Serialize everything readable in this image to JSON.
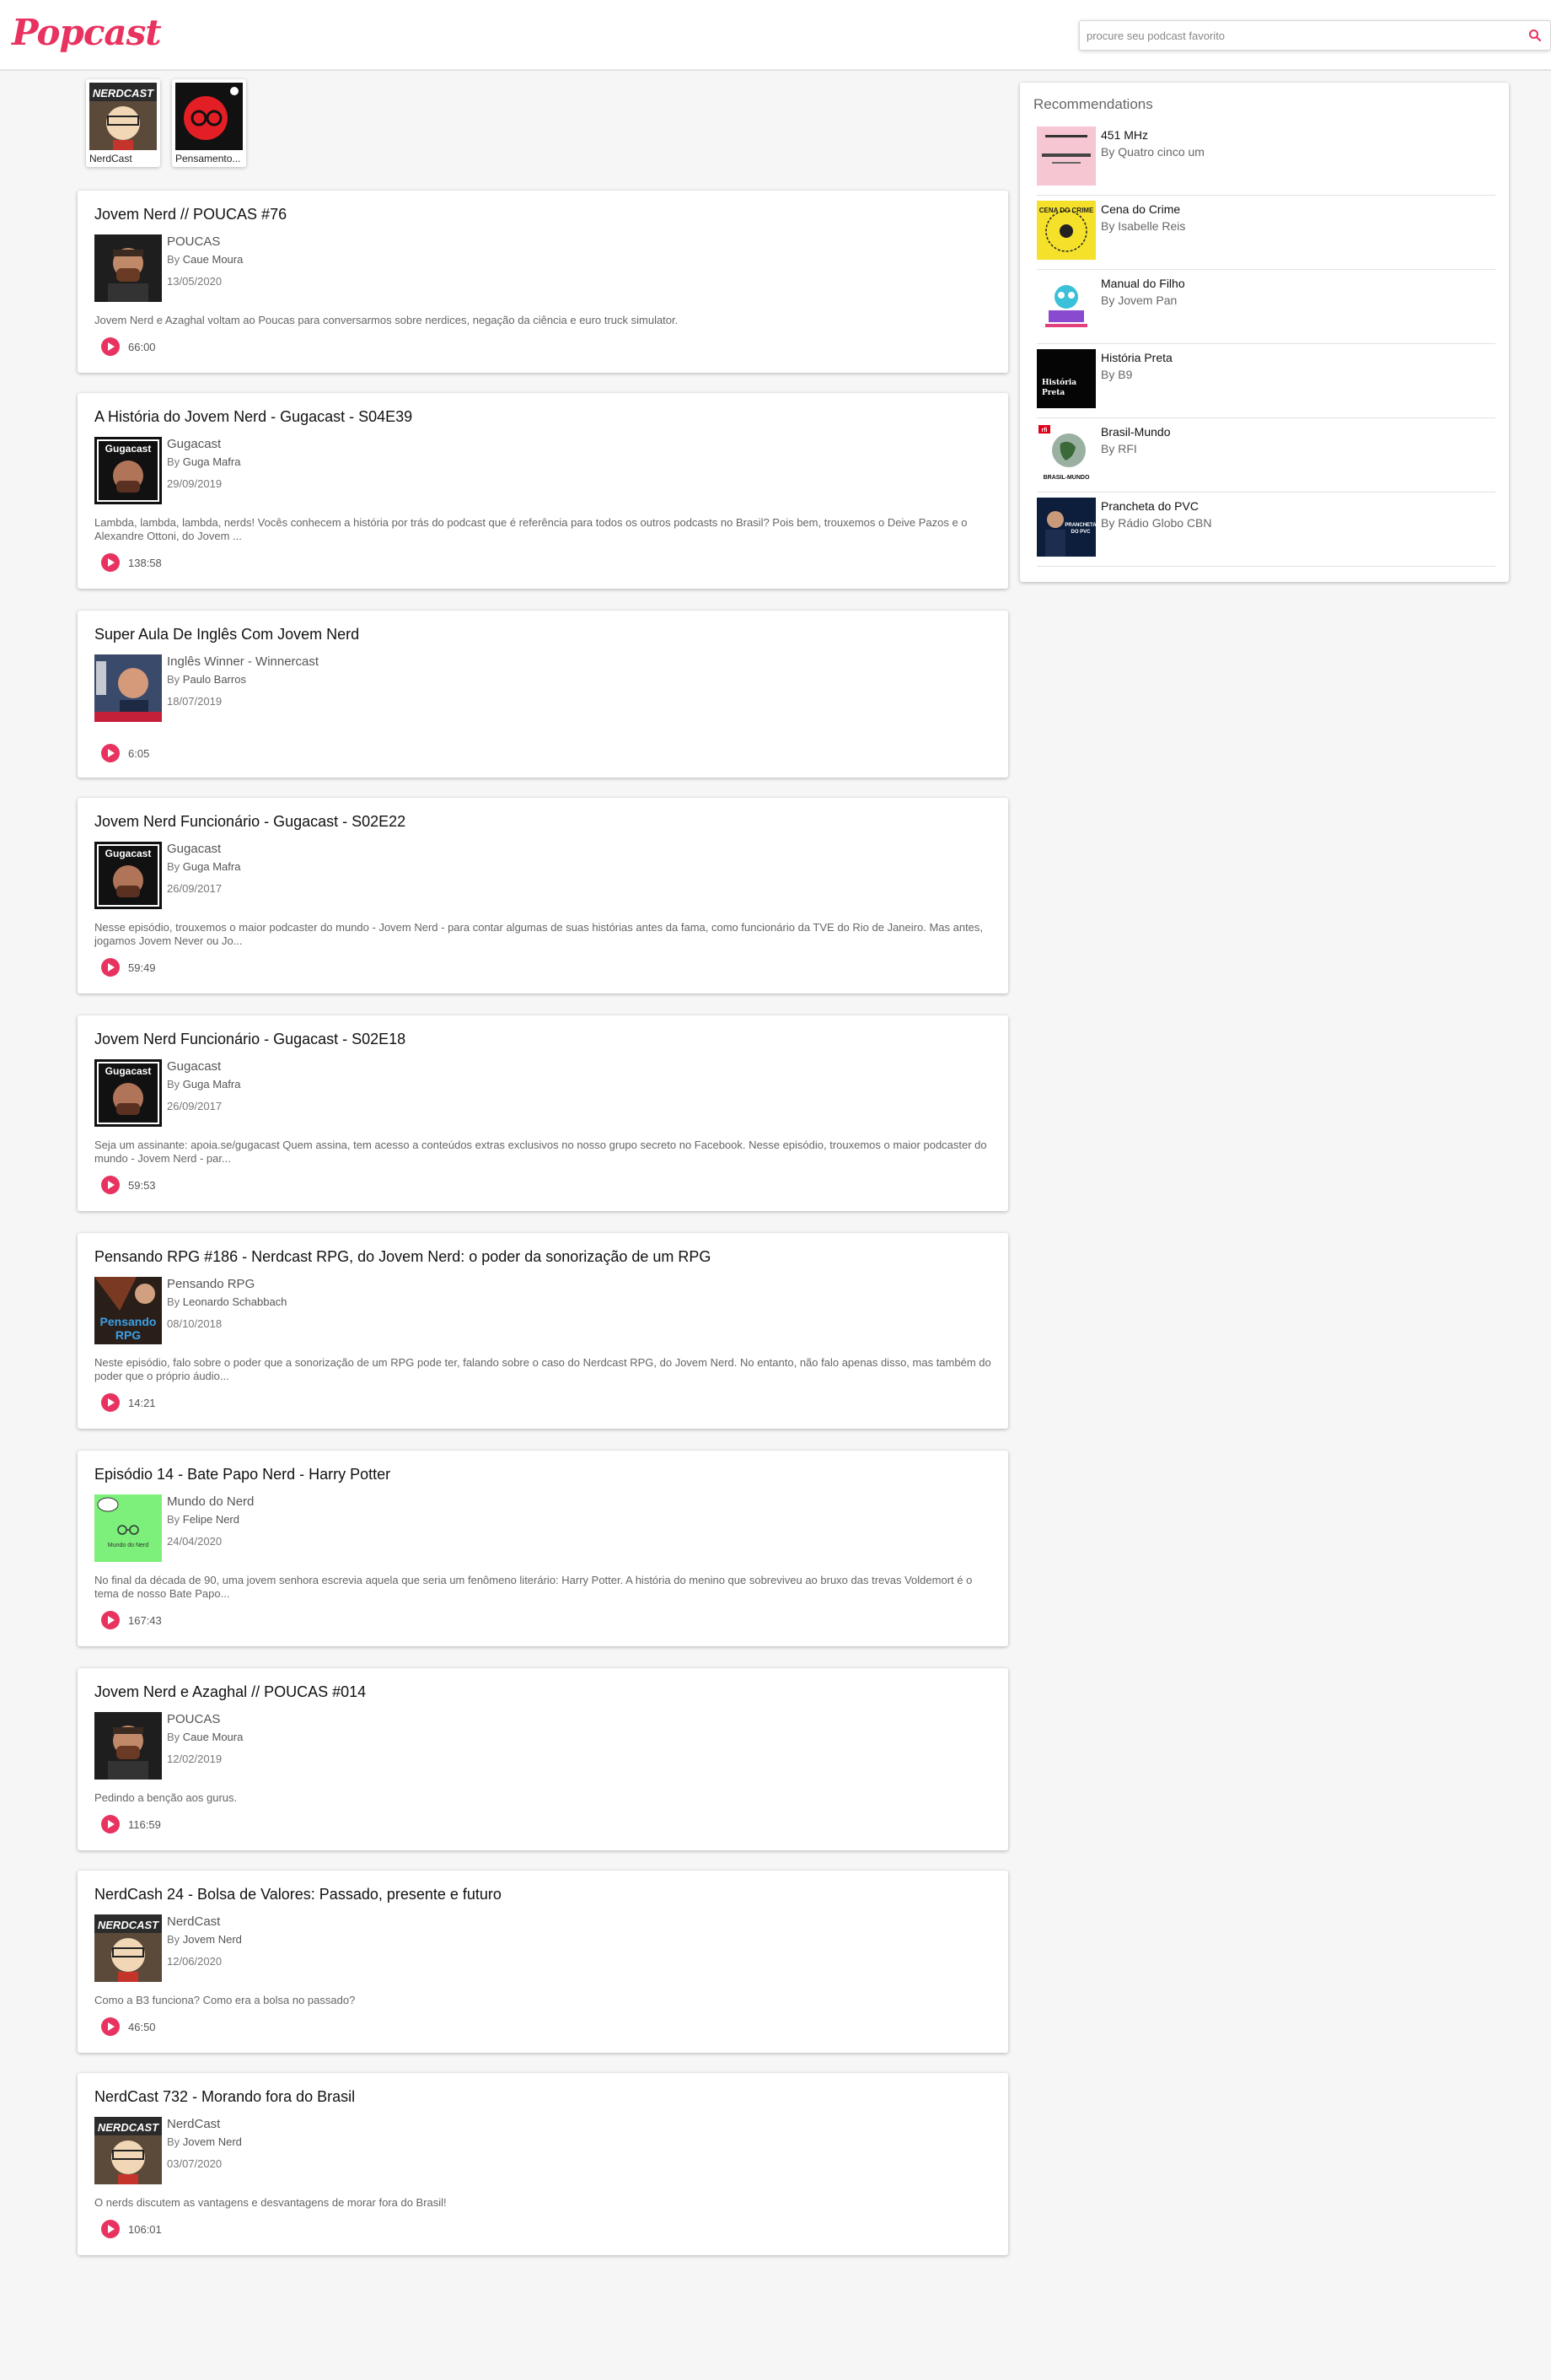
{
  "brand": {
    "logo": "Popcast",
    "accent_color": "#e8325f"
  },
  "search": {
    "placeholder": "procure seu podcast favorito",
    "value": "",
    "icon": "search-icon"
  },
  "subscriptions": [
    {
      "label": "NerdCast"
    },
    {
      "label": "Pensamento..."
    }
  ],
  "episodes": [
    {
      "title": "Jovem Nerd // POUCAS #76",
      "podcast": "POUCAS",
      "by": "By",
      "author": "Caue Moura",
      "date": "13/05/2020",
      "description": "Jovem Nerd e Azaghal voltam ao Poucas para conversarmos sobre nerdices, negação da ciência e euro truck simulator.",
      "duration": "66:00"
    },
    {
      "title": "A História do Jovem Nerd - Gugacast - S04E39",
      "podcast": "Gugacast",
      "by": "By",
      "author": "Guga Mafra",
      "date": "29/09/2019",
      "description": "Lambda, lambda, lambda, nerds! Vocês conhecem a história por trás do podcast que é referência para todos os outros podcasts no Brasil? Pois bem, trouxemos o Deive Pazos e o Alexandre Ottoni, do Jovem ...",
      "duration": "138:58"
    },
    {
      "title": "Super Aula De Inglês Com Jovem Nerd",
      "podcast": "Inglês Winner - Winnercast",
      "by": "By",
      "author": "Paulo Barros",
      "date": "18/07/2019",
      "description": "",
      "duration": "6:05"
    },
    {
      "title": "Jovem Nerd Funcionário - Gugacast - S02E22",
      "podcast": "Gugacast",
      "by": "By",
      "author": "Guga Mafra",
      "date": "26/09/2017",
      "description": "Nesse episódio, trouxemos o maior podcaster do mundo - Jovem Nerd - para contar algumas de suas histórias antes da fama, como funcionário da TVE do Rio de Janeiro. Mas antes, jogamos Jovem Never ou Jo...",
      "duration": "59:49"
    },
    {
      "title": "Jovem Nerd Funcionário - Gugacast - S02E18",
      "podcast": "Gugacast",
      "by": "By",
      "author": "Guga Mafra",
      "date": "26/09/2017",
      "description": "Seja um assinante: apoia.se/gugacast Quem assina, tem acesso a conteúdos extras exclusivos no nosso grupo secreto no Facebook. Nesse episódio, trouxemos o maior podcaster do mundo - Jovem Nerd - par...",
      "duration": "59:53"
    },
    {
      "title": "Pensando RPG #186 - Nerdcast RPG, do Jovem Nerd: o poder da sonorização de um RPG",
      "podcast": "Pensando RPG",
      "by": "By",
      "author": "Leonardo Schabbach",
      "date": "08/10/2018",
      "description": "Neste episódio, falo sobre o poder que a sonorização de um RPG pode ter, falando sobre o caso do Nerdcast RPG, do Jovem Nerd. No entanto, não falo apenas disso, mas também do poder que o próprio áudio...",
      "duration": "14:21"
    },
    {
      "title": "Episódio 14 - Bate Papo Nerd - Harry Potter",
      "podcast": "Mundo do Nerd",
      "by": "By",
      "author": "Felipe Nerd",
      "date": "24/04/2020",
      "description": "No final da década de 90, uma jovem senhora escrevia aquela que seria um fenômeno literário: Harry Potter. A história do menino que sobreviveu ao bruxo das trevas Voldemort é o tema de nosso Bate Papo...",
      "duration": "167:43"
    },
    {
      "title": "Jovem Nerd e Azaghal // POUCAS #014",
      "podcast": "POUCAS",
      "by": "By",
      "author": "Caue Moura",
      "date": "12/02/2019",
      "description": "Pedindo a benção aos gurus.",
      "duration": "116:59"
    },
    {
      "title": "NerdCash 24 - Bolsa de Valores: Passado, presente e futuro",
      "podcast": "NerdCast",
      "by": "By",
      "author": "Jovem Nerd",
      "date": "12/06/2020",
      "description": "Como a B3 funciona? Como era a bolsa no passado?",
      "duration": "46:50"
    },
    {
      "title": "NerdCast 732 - Morando fora do Brasil",
      "podcast": "NerdCast",
      "by": "By",
      "author": "Jovem Nerd",
      "date": "03/07/2020",
      "description": "O nerds discutem as vantagens e desvantagens de morar fora do Brasil!",
      "duration": "106:01"
    }
  ],
  "recommendations": {
    "title": "Recommendations",
    "items": [
      {
        "name": "451 MHz",
        "author": "By Quatro cinco um"
      },
      {
        "name": "Cena do Crime",
        "author": "By Isabelle Reis"
      },
      {
        "name": "Manual do Filho",
        "author": "By Jovem Pan"
      },
      {
        "name": "História Preta",
        "author": "By B9"
      },
      {
        "name": "Brasil-Mundo",
        "author": "By RFI"
      },
      {
        "name": "Prancheta do PVC",
        "author": "By Rádio Globo CBN"
      }
    ]
  },
  "artwork_text": {
    "nerdcast": "NERDCAST",
    "gugacast": "Gugacast",
    "pensando_rpg": "Pensando RPG",
    "mundo_do_nerd": "Mundo do Nerd",
    "cena_do_crime": "CENA DO CRIME",
    "historia_preta": "História Preta",
    "brasil_mundo": "BRASIL-MUNDO",
    "rfi": "rfi",
    "prancheta": "PRANCHETA DO PVC"
  }
}
